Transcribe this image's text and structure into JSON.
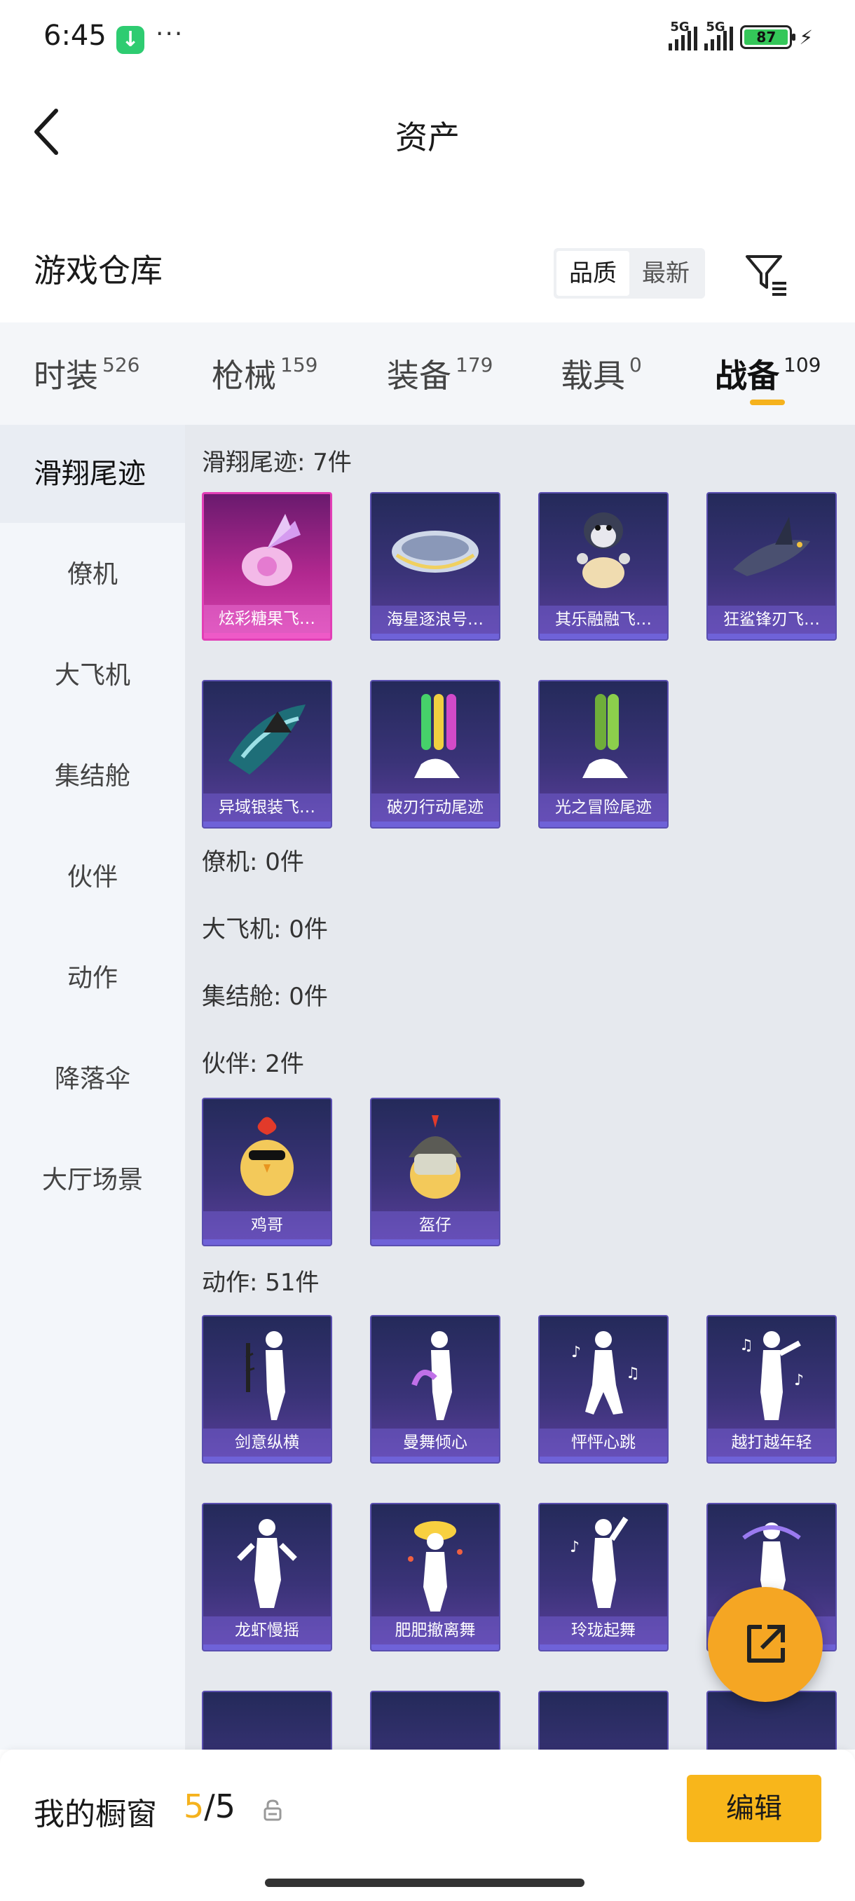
{
  "status_bar": {
    "time": "6:45",
    "download_icon": "↓",
    "more": "···",
    "network1": "5G",
    "network2": "5G",
    "battery": "87",
    "battery_level_percent": 87
  },
  "header": {
    "title": "资产"
  },
  "warehouse": {
    "title": "游戏仓库",
    "sort_options": [
      "品质",
      "最新"
    ],
    "active_sort": "品质"
  },
  "tabs": [
    {
      "label": "时装",
      "count": "526"
    },
    {
      "label": "枪械",
      "count": "159"
    },
    {
      "label": "装备",
      "count": "179"
    },
    {
      "label": "载具",
      "count": "0"
    },
    {
      "label": "战备",
      "count": "109"
    }
  ],
  "sidebar": {
    "items": [
      "滑翔尾迹",
      "僚机",
      "大飞机",
      "集结舱",
      "伙伴",
      "动作",
      "降落伞",
      "大厅场景"
    ],
    "active": "滑翔尾迹"
  },
  "sections": {
    "glide": {
      "label": "滑翔尾迹: 7件",
      "items": [
        "炫彩糖果飞…",
        "海星逐浪号…",
        "其乐融融飞…",
        "狂鲨锋刃飞…",
        "异域银装飞…",
        "破刃行动尾迹",
        "光之冒险尾迹"
      ]
    },
    "wingman": {
      "label": "僚机: 0件"
    },
    "plane": {
      "label": "大飞机: 0件"
    },
    "pod": {
      "label": "集结舱: 0件"
    },
    "companion": {
      "label": "伙伴: 2件",
      "items": [
        "鸡哥",
        "盔仔"
      ]
    },
    "emote": {
      "label": "动作: 51件",
      "items": [
        "剑意纵横",
        "曼舞倾心",
        "怦怦心跳",
        "越打越年轻",
        "龙虾慢摇",
        "肥肥撤离舞",
        "玲珑起舞",
        ""
      ]
    }
  },
  "bottom_bar": {
    "showcase_label": "我的橱窗",
    "showcase_current": "5",
    "showcase_sep": "/",
    "showcase_total": "5",
    "edit_label": "编辑"
  },
  "colors": {
    "accent": "#f5b21d",
    "card_purple": "#3a3378",
    "card_pink": "#d845b0"
  },
  "icons": [
    "back-arrow-icon",
    "filter-icon",
    "share-icon",
    "lock-icon",
    "download-icon",
    "battery-icon",
    "signal-icon"
  ]
}
